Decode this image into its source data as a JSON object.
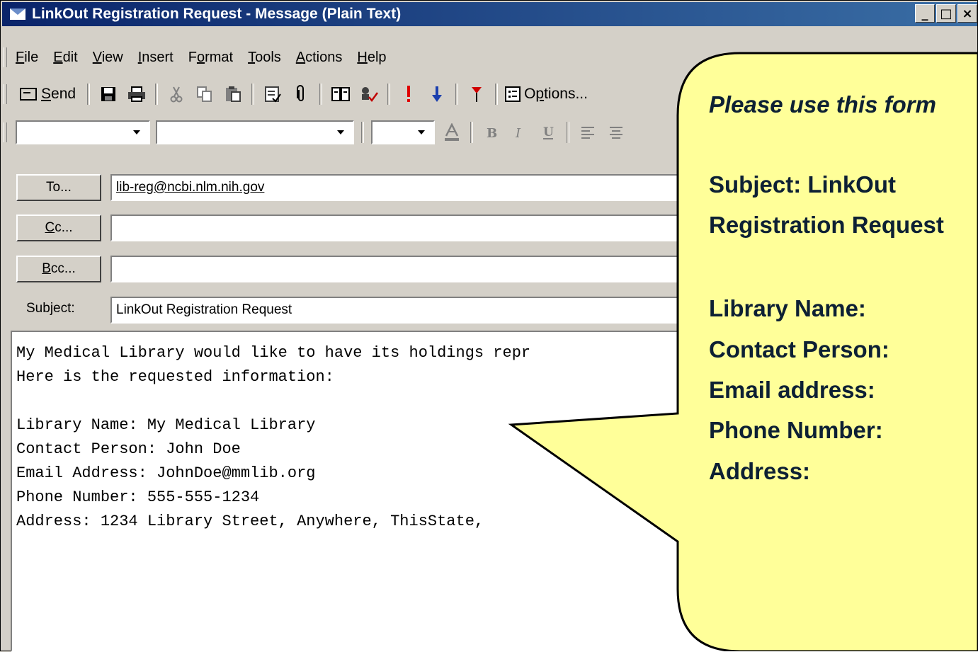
{
  "window": {
    "title": "LinkOut Registration Request - Message (Plain Text)",
    "min_label": "_",
    "max_label": "□",
    "close_label": "×"
  },
  "menu": [
    {
      "pre": "",
      "key": "F",
      "post": "ile"
    },
    {
      "pre": "",
      "key": "E",
      "post": "dit"
    },
    {
      "pre": "",
      "key": "V",
      "post": "iew"
    },
    {
      "pre": "",
      "key": "I",
      "post": "nsert"
    },
    {
      "pre": "F",
      "key": "o",
      "post": "rmat"
    },
    {
      "pre": "",
      "key": "T",
      "post": "ools"
    },
    {
      "pre": "",
      "key": "A",
      "post": "ctions"
    },
    {
      "pre": "",
      "key": "H",
      "post": "elp"
    }
  ],
  "toolbar": {
    "send_pre": "",
    "send_key": "S",
    "send_post": "end",
    "options_pre": "O",
    "options_key": "p",
    "options_post": "tions..."
  },
  "fields": {
    "to_btn_pre": "To",
    "to_btn_key": "",
    "to_btn_post": "...",
    "cc_btn_key": "C",
    "cc_btn_post": "c...",
    "bcc_btn_key": "B",
    "bcc_btn_post": "cc...",
    "to_value": "lib-reg@ncbi.nlm.nih.gov",
    "cc_value": "",
    "bcc_value": "",
    "subject_label_pre": "Sub",
    "subject_label_key": "j",
    "subject_label_post": "ect:",
    "subject_value": "LinkOut Registration Request"
  },
  "body": {
    "line1": "My Medical Library would like to have its holdings repr",
    "line2": "Here is the requested information:",
    "line3": "Library Name: My Medical Library",
    "line4": "Contact Person: John Doe",
    "line5": "Email Address: JohnDoe@mmlib.org",
    "line6": "Phone Number: 555-555-1234",
    "line7": "Address: 1234 Library Street, Anywhere, ThisState,"
  },
  "callout": {
    "intro": "Please use this form",
    "subject_1": "Subject: LinkOut",
    "subject_2": "Registration Request",
    "library": "Library Name:",
    "contact": "Contact Person:",
    "email": "Email address:",
    "phone": "Phone Number:",
    "address": "Address:"
  },
  "colors": {
    "callout_fill": "#ffff99",
    "callout_text": "#0d2034",
    "titlebar": "#0a246a",
    "chrome": "#d4d0c8"
  }
}
